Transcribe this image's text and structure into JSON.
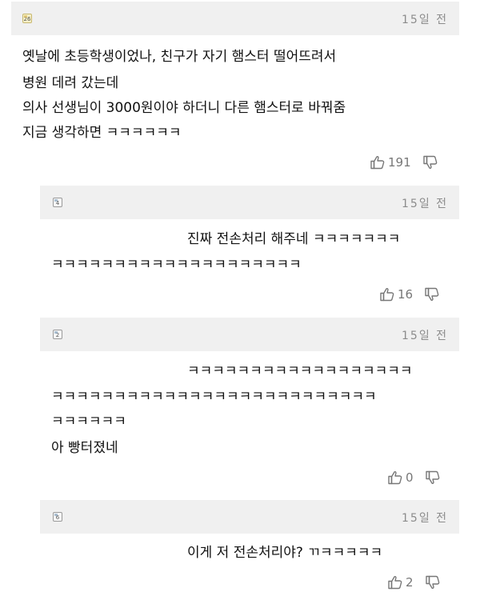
{
  "comments": [
    {
      "grade": "26",
      "time": "15일 전",
      "lines": [
        "옛날에 초등학생이었나, 친구가 자기 햄스터 떨어뜨려서",
        "병원 데려 갔는데",
        "의사 선생님이 3000원이야 하더니 다른 햄스터로 바꿔줌",
        "지금 생각하면 ㅋㅋㅋㅋㅋㅋ"
      ],
      "likes": "191"
    },
    {
      "grade": "4",
      "time": "15일 전",
      "lines": [
        "진짜 전손처리 해주네 ㅋㅋㅋㅋㅋㅋㅋ",
        "ㅋㅋㅋㅋㅋㅋㅋㅋㅋㅋㅋㅋㅋㅋㅋㅋㅋㅋㅋㅋ"
      ],
      "likes": "16"
    },
    {
      "grade": "2",
      "time": "15일 전",
      "lines": [
        "ㅋㅋㅋㅋㅋㅋㅋㅋㅋㅋㅋㅋㅋㅋㅋㅋㅋㅋ",
        "ㅋㅋㅋㅋㅋㅋㅋㅋㅋㅋㅋㅋㅋㅋㅋㅋㅋㅋㅋㅋㅋㅋㅋㅋㅋㅋ",
        "ㅋㅋㅋㅋㅋㅋ",
        "아 빵터졌네"
      ],
      "likes": "0"
    },
    {
      "grade": "6",
      "time": "15일 전",
      "lines": [
        "이게 저 전손처리야? ㄲㅋㅋㅋㅋㅋ"
      ],
      "likes": "2"
    }
  ]
}
